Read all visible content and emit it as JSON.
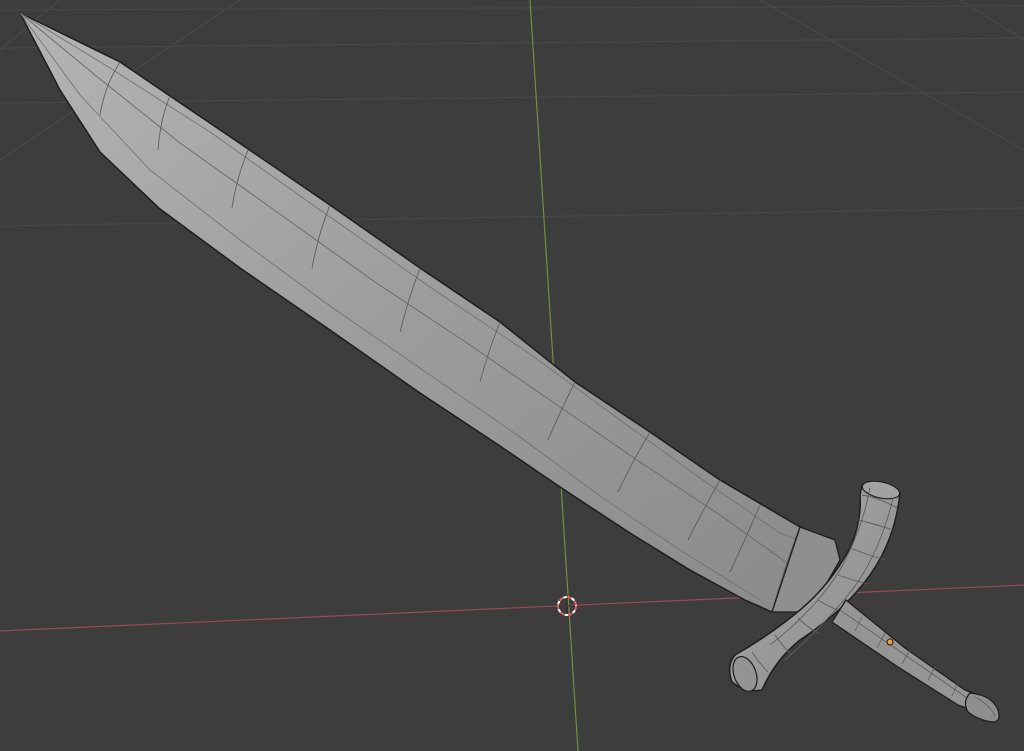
{
  "app": {
    "name": "3D viewport",
    "view": "perspective",
    "shading": "solid"
  },
  "colors": {
    "background": "#3d3d3d",
    "grid_line": "#4a4a4a",
    "x_axis": "#9a4a55",
    "y_axis": "#6f8f3a",
    "mesh_fill": "#9b9b9b",
    "mesh_wire": "#505050",
    "mesh_outline": "#1e1e1e",
    "cursor_ring": "#e06060",
    "origin_dot": "#ff9a2a"
  },
  "scene": {
    "objects": [
      {
        "name": "sword",
        "type": "mesh",
        "parts": [
          "blade",
          "crossguard",
          "grip",
          "pommel"
        ]
      }
    ],
    "cursor_icon": "3d-cursor-icon",
    "origin_icon": "object-origin-icon"
  }
}
